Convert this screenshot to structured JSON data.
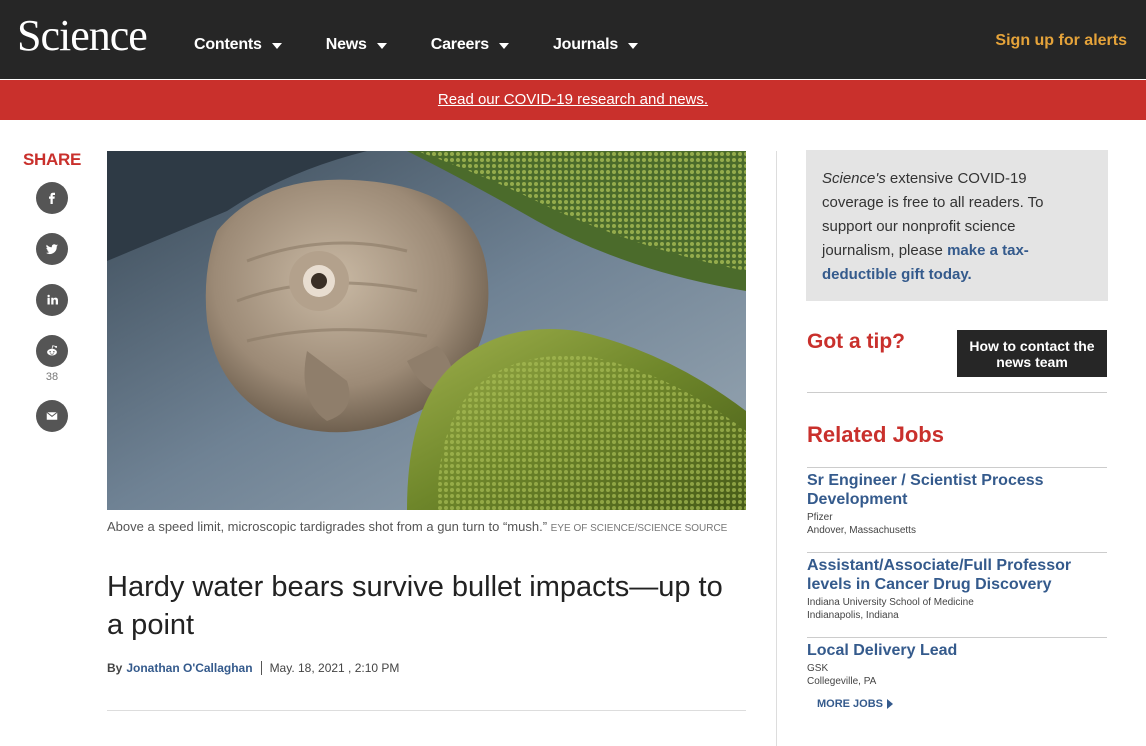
{
  "header": {
    "logo": "Science",
    "nav": [
      "Contents",
      "News",
      "Careers",
      "Journals"
    ],
    "alerts": "Sign up for alerts"
  },
  "banner": {
    "text": "Read our COVID-19 research and news."
  },
  "share": {
    "title": "SHARE",
    "icons": [
      "facebook-icon",
      "twitter-icon",
      "linkedin-icon",
      "reddit-icon",
      "email-icon"
    ],
    "reddit_count": "38"
  },
  "article": {
    "caption": "Above a speed limit, microscopic tardigrades shot from a gun turn to “mush.”",
    "credit": "EYE OF SCIENCE/SCIENCE SOURCE",
    "headline": "Hardy water bears survive bullet impacts—up to a point",
    "by": "By",
    "author": "Jonathan O'Callaghan",
    "date": "May. 18, 2021 , 2:10 PM"
  },
  "sidebar": {
    "donate_italic": "Science's",
    "donate_text": " extensive COVID-19 coverage is free to all readers. To support our nonprofit science journalism, please ",
    "donate_link": "make a tax-deductible gift today.",
    "tip_title": "Got a tip?",
    "contact_button": "How to contact the news team",
    "related_title": "Related Jobs",
    "jobs": [
      {
        "title": "Sr Engineer / Scientist Process Development",
        "org": "Pfizer",
        "loc": "Andover, Massachusetts"
      },
      {
        "title": "Assistant/Associate/Full Professor levels in Cancer Drug Discovery",
        "org": "Indiana University School of Medicine",
        "loc": "Indianapolis, Indiana"
      },
      {
        "title": "Local Delivery Lead",
        "org": "GSK",
        "loc": "Collegeville, PA"
      }
    ],
    "more_jobs": "MORE JOBS"
  },
  "colors": {
    "header_bg": "#262626",
    "banner_bg": "#c9302c",
    "accent_red": "#c9302c",
    "alerts": "#e5a33a",
    "link_blue": "#345a8c"
  }
}
